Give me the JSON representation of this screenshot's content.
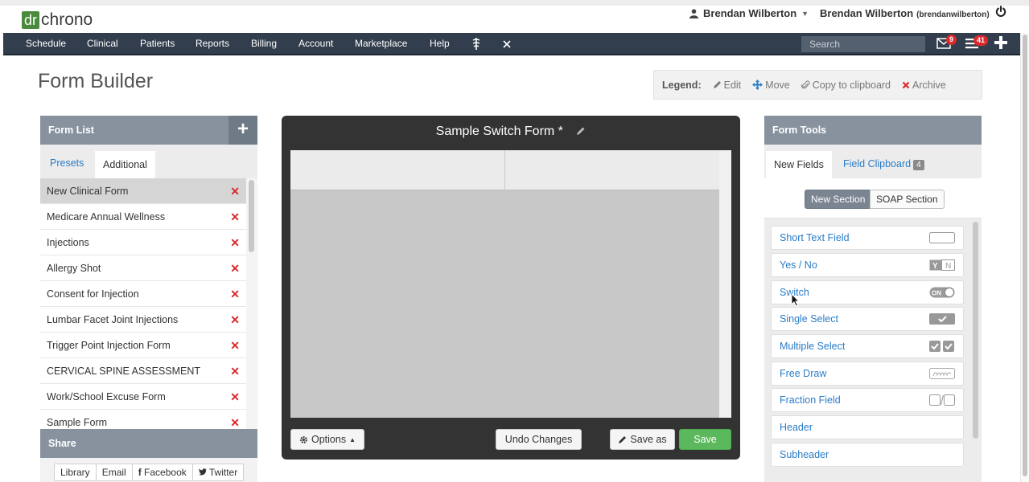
{
  "app": {
    "logo_dr": "dr",
    "logo_chrono": "chrono"
  },
  "user": {
    "name": "Brendan Wilberton",
    "account_name": "Brendan Wilberton",
    "account_handle": "(brendanwilberton)"
  },
  "nav": {
    "items": [
      "Schedule",
      "Clinical",
      "Patients",
      "Reports",
      "Billing",
      "Account",
      "Marketplace",
      "Help"
    ],
    "search_placeholder": "Search",
    "messages_count": "9",
    "tasks_count": "41"
  },
  "page": {
    "title": "Form Builder"
  },
  "legend": {
    "label": "Legend:",
    "edit": "Edit",
    "move": "Move",
    "copy": "Copy to clipboard",
    "archive": "Archive"
  },
  "form_list": {
    "title": "Form List",
    "tabs": [
      "Presets",
      "Additional"
    ],
    "items": [
      "New Clinical Form",
      "Medicare Annual Wellness",
      "Injections",
      "Allergy Shot",
      "Consent for Injection",
      "Lumbar Facet Joint Injections",
      "Trigger Point Injection Form",
      "CERVICAL SPINE ASSESSMENT",
      "Work/School Excuse Form",
      "Sample Form"
    ]
  },
  "share": {
    "title": "Share",
    "buttons": [
      "Library",
      "Email",
      "Facebook",
      "Twitter"
    ]
  },
  "builder": {
    "form_title": "Sample Switch Form *",
    "options_label": "Options",
    "undo_label": "Undo Changes",
    "save_as_label": "Save as",
    "save_label": "Save"
  },
  "tools": {
    "title": "Form Tools",
    "tab_new": "New Fields",
    "tab_clipboard": "Field Clipboard",
    "clipboard_count": "4",
    "seg_new": "New Section",
    "seg_soap": "SOAP Section",
    "fields": [
      "Short Text Field",
      "Yes / No",
      "Switch",
      "Single Select",
      "Multiple Select",
      "Free Draw",
      "Fraction Field",
      "Header",
      "Subheader"
    ]
  },
  "colors": {
    "nav_bg": "#323e4d",
    "panel_head": "#87929e",
    "link": "#2a7cc7",
    "save_green": "#5cb85c",
    "archive_red": "#d9292b"
  }
}
